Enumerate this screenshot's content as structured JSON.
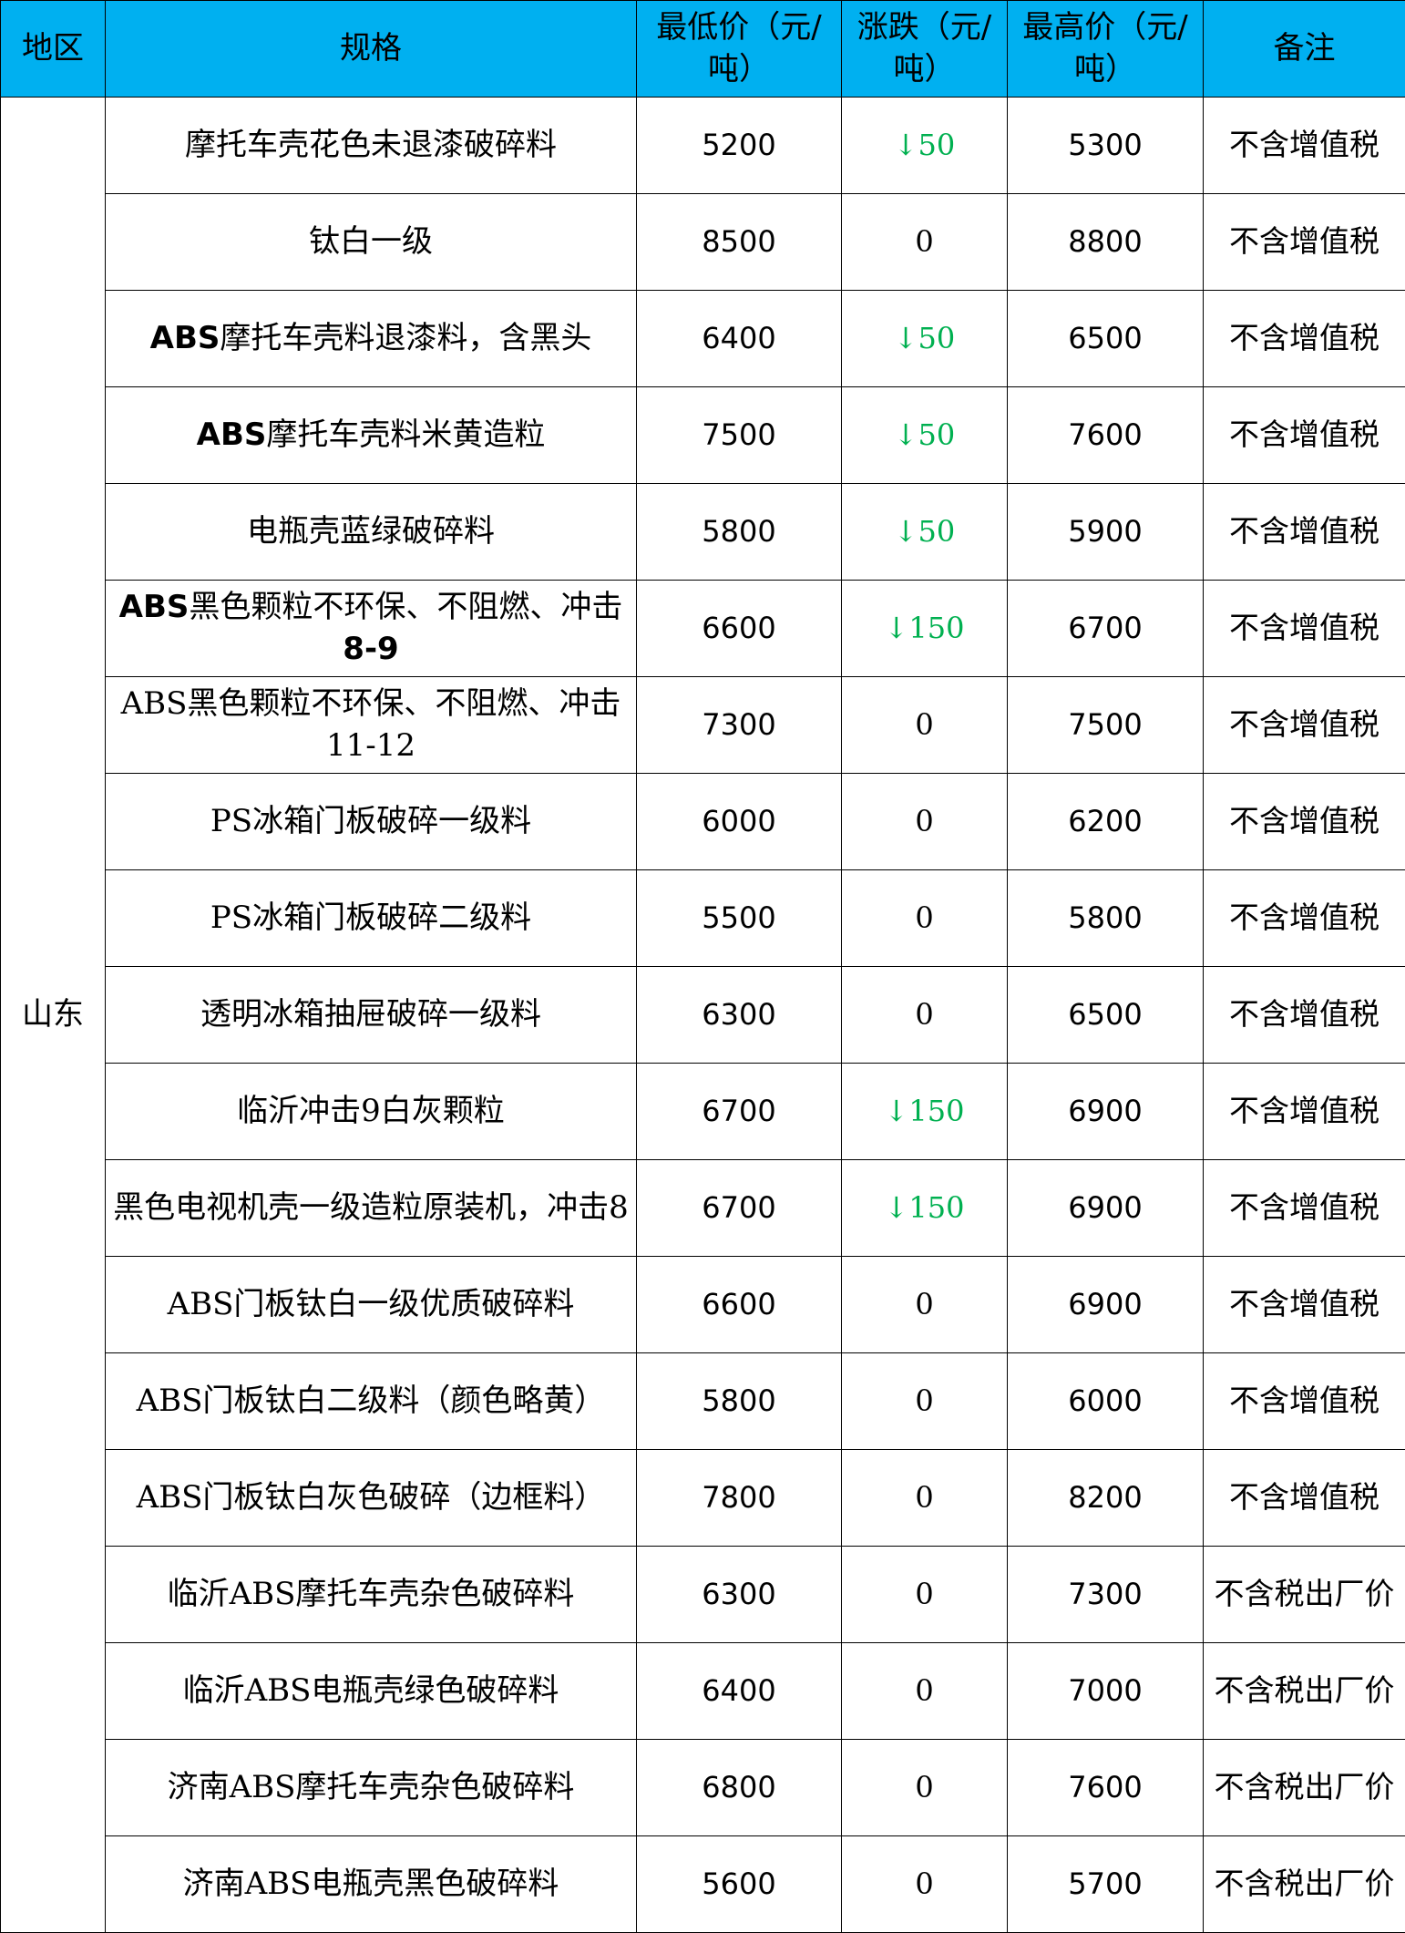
{
  "header": {
    "region": "地区",
    "spec": "规格",
    "min_price": "最低价（元/吨）",
    "change": "涨跌（元/吨）",
    "max_price": "最高价（元/吨）",
    "note": "备注"
  },
  "region": "山东",
  "colors": {
    "header_bg": "#00b0f0",
    "down_color": "#00b050"
  },
  "rows": [
    {
      "spec_bold": "",
      "spec": "摩托车壳花色未退漆破碎料",
      "min": "5200",
      "change": "↓50",
      "max": "5300",
      "note": "不含增值税"
    },
    {
      "spec_bold": "",
      "spec": "钛白一级",
      "min": "8500",
      "change": "0",
      "max": "8800",
      "note": "不含增值税"
    },
    {
      "spec_bold": "ABS",
      "spec": "摩托车壳料退漆料，含黑头",
      "min": "6400",
      "change": "↓50",
      "max": "6500",
      "note": "不含增值税"
    },
    {
      "spec_bold": "ABS",
      "spec": "摩托车壳料米黄造粒",
      "min": "7500",
      "change": "↓50",
      "max": "7600",
      "note": "不含增值税"
    },
    {
      "spec_bold": "",
      "spec": "电瓶壳蓝绿破碎料",
      "min": "5800",
      "change": "↓50",
      "max": "5900",
      "note": "不含增值税"
    },
    {
      "spec_bold": "ABS",
      "spec": "黑色颗粒不环保、不阻燃、冲击",
      "spec_bold_tail": "8-9",
      "min": "6600",
      "change": "↓150",
      "max": "6700",
      "note": "不含增值税"
    },
    {
      "spec_bold": "",
      "spec": "ABS黑色颗粒不环保、不阻燃、冲击11-12",
      "min": "7300",
      "change": "0",
      "max": "7500",
      "note": "不含增值税"
    },
    {
      "spec_bold": "",
      "spec": "PS冰箱门板破碎一级料",
      "min": "6000",
      "change": "0",
      "max": "6200",
      "note": "不含增值税"
    },
    {
      "spec_bold": "",
      "spec": "PS冰箱门板破碎二级料",
      "min": "5500",
      "change": "0",
      "max": "5800",
      "note": "不含增值税"
    },
    {
      "spec_bold": "",
      "spec": "透明冰箱抽屉破碎一级料",
      "min": "6300",
      "change": "0",
      "max": "6500",
      "note": "不含增值税"
    },
    {
      "spec_bold": "",
      "spec": "临沂冲击9白灰颗粒",
      "min": "6700",
      "change": "↓150",
      "max": "6900",
      "note": "不含增值税"
    },
    {
      "spec_bold": "",
      "spec": "黑色电视机壳一级造粒原装机，冲击8",
      "min": "6700",
      "change": "↓150",
      "max": "6900",
      "note": "不含增值税"
    },
    {
      "spec_bold": "",
      "spec": "ABS门板钛白一级优质破碎料",
      "min": "6600",
      "change": "0",
      "max": "6900",
      "note": "不含增值税"
    },
    {
      "spec_bold": "",
      "spec": "ABS门板钛白二级料（颜色略黄）",
      "min": "5800",
      "change": "0",
      "max": "6000",
      "note": "不含增值税"
    },
    {
      "spec_bold": "",
      "spec": "ABS门板钛白灰色破碎（边框料）",
      "min": "7800",
      "change": "0",
      "max": "8200",
      "note": "不含增值税"
    },
    {
      "spec_bold": "",
      "spec": "临沂ABS摩托车壳杂色破碎料",
      "min": "6300",
      "change": "0",
      "max": "7300",
      "note": "不含税出厂价"
    },
    {
      "spec_bold": "",
      "spec": "临沂ABS电瓶壳绿色破碎料",
      "min": "6400",
      "change": "0",
      "max": "7000",
      "note": "不含税出厂价"
    },
    {
      "spec_bold": "",
      "spec": "济南ABS摩托车壳杂色破碎料",
      "min": "6800",
      "change": "0",
      "max": "7600",
      "note": "不含税出厂价"
    },
    {
      "spec_bold": "",
      "spec": "济南ABS电瓶壳黑色破碎料",
      "min": "5600",
      "change": "0",
      "max": "5700",
      "note": "不含税出厂价"
    }
  ]
}
